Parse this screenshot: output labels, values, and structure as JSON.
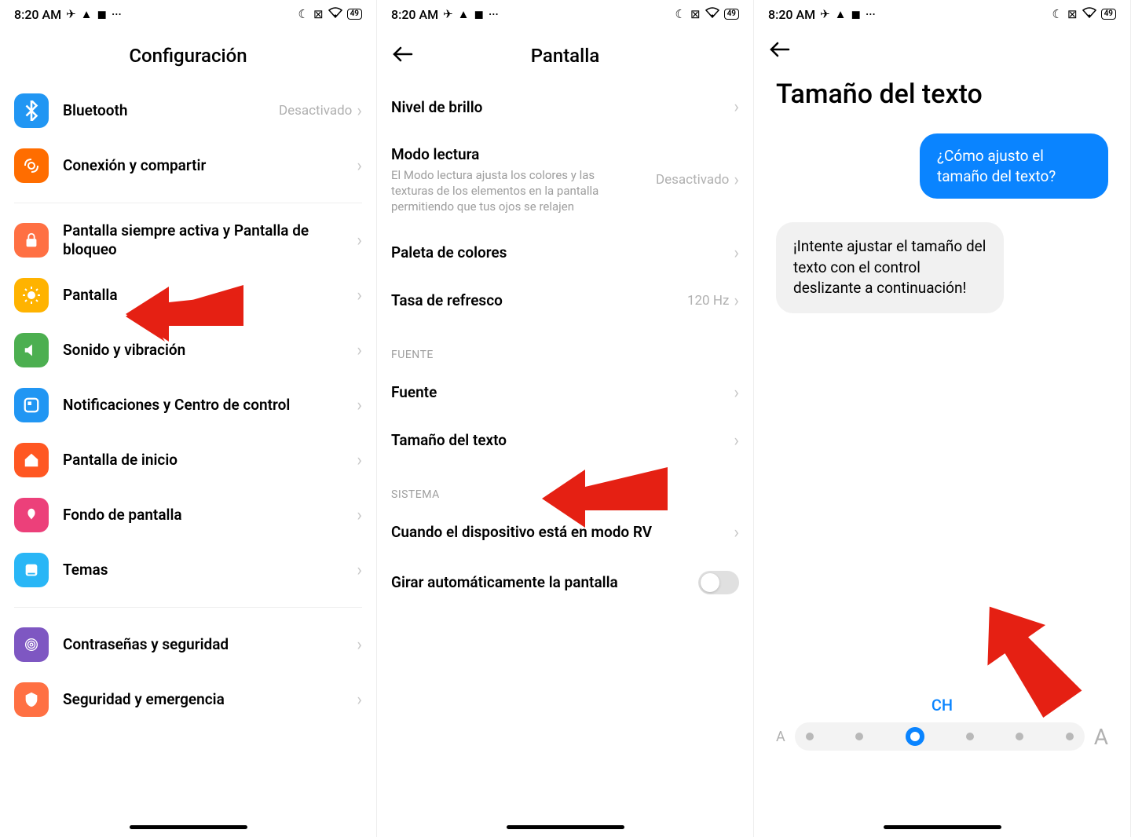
{
  "status": {
    "time": "8:20 AM",
    "battery": "49"
  },
  "screen1": {
    "title": "Configuración",
    "bluetooth": {
      "label": "Bluetooth",
      "value": "Desactivado"
    },
    "connection": {
      "label": "Conexión y compartir"
    },
    "aod": {
      "label": "Pantalla siempre activa y Pantalla de bloqueo"
    },
    "display": {
      "label": "Pantalla"
    },
    "sound": {
      "label": "Sonido y vibración"
    },
    "notif": {
      "label": "Notificaciones y Centro de control"
    },
    "home": {
      "label": "Pantalla de inicio"
    },
    "wallpaper": {
      "label": "Fondo de pantalla"
    },
    "themes": {
      "label": "Temas"
    },
    "passwords": {
      "label": "Contraseñas y seguridad"
    },
    "safety": {
      "label": "Seguridad y emergencia"
    }
  },
  "screen2": {
    "title": "Pantalla",
    "brightness": "Nivel de brillo",
    "reading_title": "Modo lectura",
    "reading_desc": "El Modo lectura ajusta los colores y las texturas de los elementos en la pantalla permitiendo que tus ojos se relajen",
    "reading_value": "Desactivado",
    "color_palette": "Paleta de colores",
    "refresh": "Tasa de refresco",
    "refresh_value": "120 Hz",
    "section_font": "FUENTE",
    "font": "Fuente",
    "text_size": "Tamaño del texto",
    "section_system": "SISTEMA",
    "vr_mode": "Cuando el dispositivo está en modo RV",
    "auto_rotate": "Girar automáticamente la pantalla"
  },
  "screen3": {
    "title": "Tamaño del texto",
    "bubble_q": "¿Cómo ajusto el tamaño del texto?",
    "bubble_a": "¡Intente ajustar el tamaño del texto con el control deslizante a continuación!",
    "slider_label": "CH",
    "letter": "A"
  }
}
